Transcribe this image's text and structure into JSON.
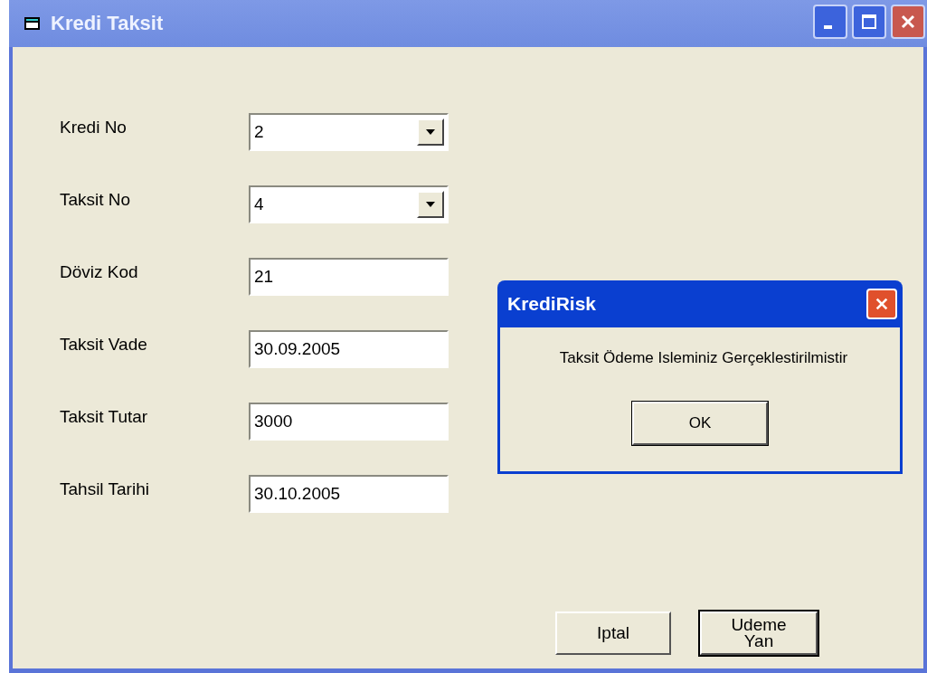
{
  "window": {
    "title": "Kredi Taksit"
  },
  "fields": [
    {
      "label": "Kredi No",
      "kind": "combo",
      "value": "2"
    },
    {
      "label": "Taksit No",
      "kind": "combo",
      "value": "4"
    },
    {
      "label": "Döviz Kod",
      "kind": "text",
      "value": "21"
    },
    {
      "label": "Taksit Vade",
      "kind": "text",
      "value": "30.09.2005"
    },
    {
      "label": "Taksit Tutar",
      "kind": "text",
      "value": "3000"
    },
    {
      "label": "Tahsil Tarihi",
      "kind": "text",
      "value": "30.10.2005"
    }
  ],
  "buttons": [
    {
      "label": "Iptal",
      "default": false
    },
    {
      "label": "Udeme Yan",
      "default": true
    }
  ],
  "dialog": {
    "title": "KrediRisk",
    "message": "Taksit Ödeme Isleminiz Gerçeklestirilmistir",
    "button": "OK"
  }
}
